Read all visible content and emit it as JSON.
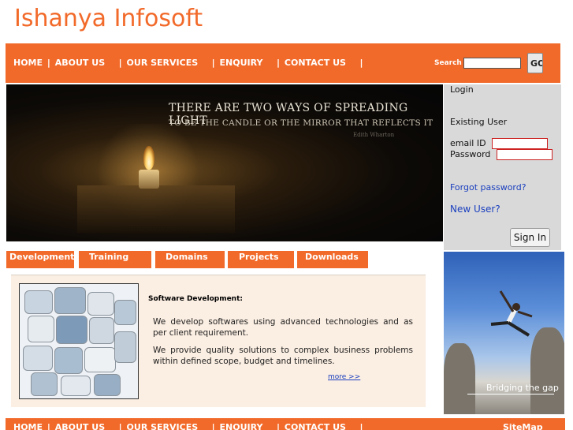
{
  "logo": {
    "text": "Ishanya Infosoft"
  },
  "nav": {
    "items": [
      "HOME",
      "ABOUT US",
      "OUR SERVICES",
      "ENQUIRY",
      "CONTACT US"
    ],
    "separator": "|",
    "search_label": "Search",
    "search_value": "",
    "go_label": "GO"
  },
  "banner": {
    "line1": "THERE ARE TWO WAYS OF SPREADING LIGHT",
    "line2": "TO BE THE CANDLE OR THE MIRROR THAT REFLECTS IT",
    "signature": "Edith Wharton"
  },
  "login": {
    "title": "Login",
    "existing_user": "Existing User",
    "email_label": "email ID",
    "password_label": "Password",
    "forgot_link": "Forgot password?",
    "new_user_link": "New User?",
    "signin_label": "Sign In"
  },
  "tabs": [
    "Development",
    "Training",
    "Domains",
    "Projects",
    "Downloads"
  ],
  "content": {
    "heading": "Software Development:",
    "para1": "We develop softwares using advanced technologies and as per client requirement.",
    "para2": "We provide quality solutions to complex business problems within defined scope, budget and timelines.",
    "more_link": "more >>"
  },
  "side_image": {
    "caption": "Bridging the gap"
  },
  "footer": {
    "items": [
      "HOME",
      "ABOUT US",
      "OUR SERVICES",
      "ENQUIRY",
      "CONTACT US"
    ],
    "sitemap": "SiteMap"
  },
  "colors": {
    "accent": "#f26a2a",
    "link": "#1a3fbf",
    "panel": "#d9d9d9",
    "content_bg": "#fbeee2"
  }
}
